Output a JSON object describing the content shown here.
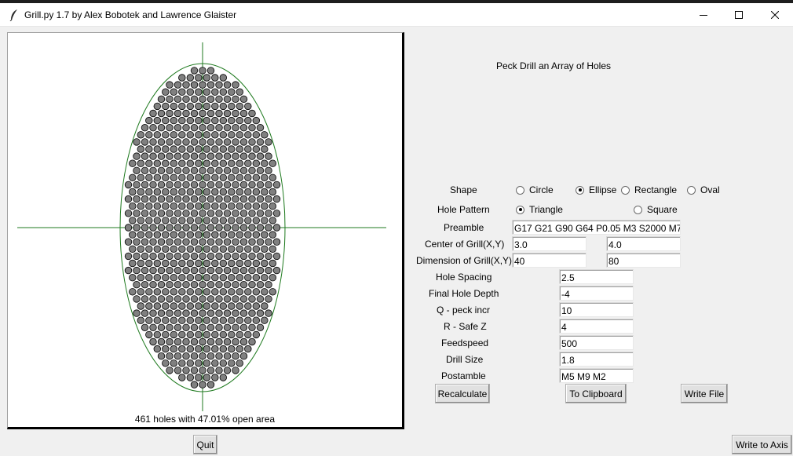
{
  "window": {
    "title": "Grill.py 1.7 by Alex Bobotek and Lawrence Glaister"
  },
  "canvas": {
    "status": "461 holes with 47.01% open area"
  },
  "heading": "Peck Drill an Array of Holes",
  "shape": {
    "label": "Shape",
    "options": [
      "Circle",
      "Ellipse",
      "Rectangle",
      "Oval"
    ],
    "selected": "Ellipse"
  },
  "hole_pattern": {
    "label": "Hole Pattern",
    "options": [
      "Triangle",
      "Square"
    ],
    "selected": "Triangle"
  },
  "fields": {
    "preamble": {
      "label": "Preamble",
      "value": "G17 G21 G90 G64 P0.05 M3 S2000 M7"
    },
    "center": {
      "label": "Center of Grill(X,Y)",
      "x": "3.0",
      "y": "4.0"
    },
    "dimension": {
      "label": "Dimension of Grill(X,Y)",
      "x": "40",
      "y": "80"
    },
    "hole_spacing": {
      "label": "Hole Spacing",
      "value": "2.5"
    },
    "final_depth": {
      "label": "Final Hole Depth",
      "value": "-4"
    },
    "q_peck": {
      "label": "Q - peck incr",
      "value": "10"
    },
    "r_safe": {
      "label": "R - Safe Z",
      "value": "4"
    },
    "feedspeed": {
      "label": "Feedspeed",
      "value": "500"
    },
    "drill_size": {
      "label": "Drill Size",
      "value": "1.8"
    },
    "postamble": {
      "label": "Postamble",
      "value": "M5 M9 M2"
    }
  },
  "buttons": {
    "recalculate": "Recalculate",
    "clipboard": "To Clipboard",
    "write_file": "Write File",
    "quit": "Quit",
    "write_axis": "Write to Axis"
  },
  "icons": {
    "app": "feather-icon",
    "minimize": "minimize-icon",
    "maximize": "maximize-icon",
    "close": "close-icon"
  }
}
